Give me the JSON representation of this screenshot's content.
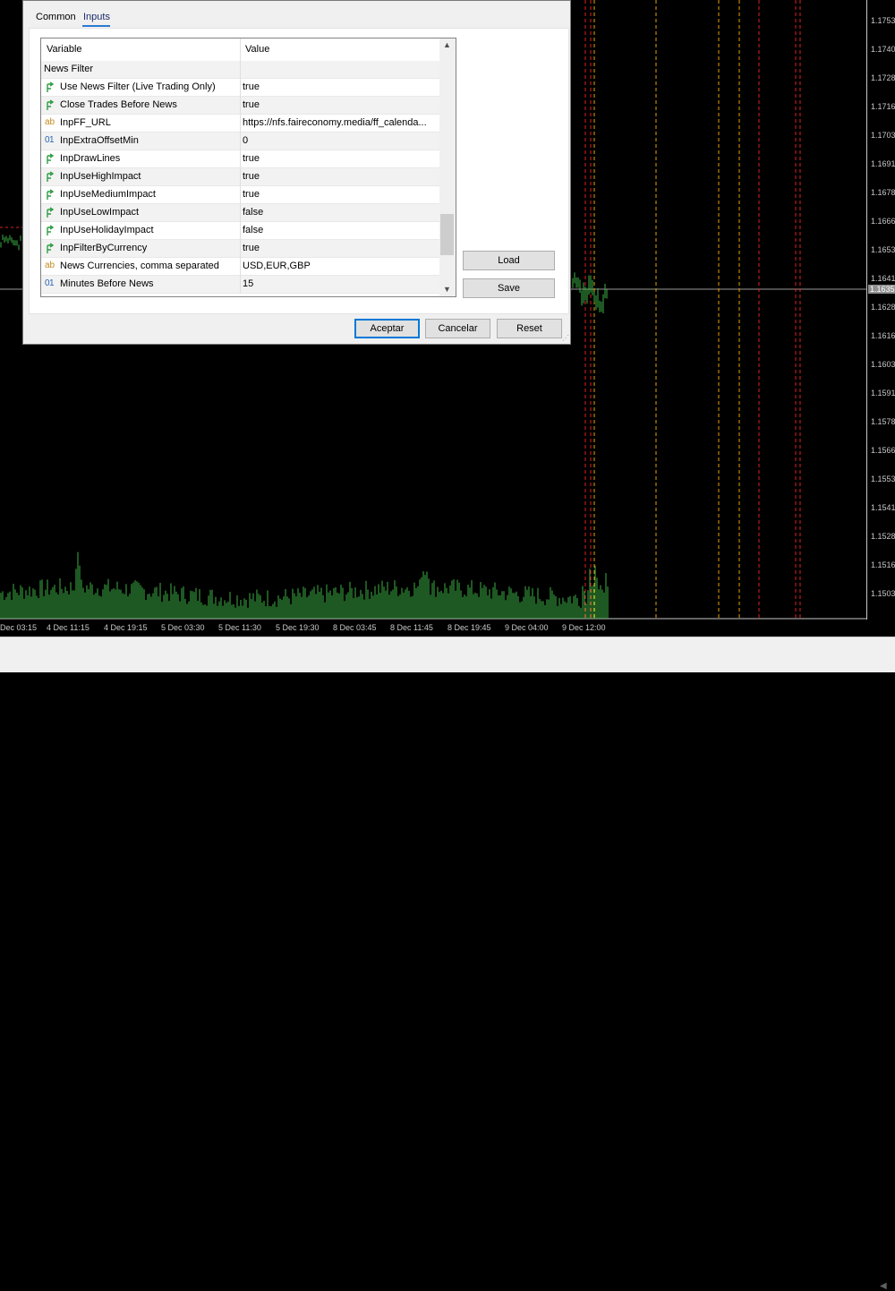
{
  "dialog": {
    "tabs": [
      {
        "label": "Common"
      },
      {
        "label": "Inputs"
      }
    ],
    "grid": {
      "headers": {
        "variable": "Variable",
        "value": "Value"
      },
      "rows": [
        {
          "type": "group",
          "name": "News Filter",
          "value": ""
        },
        {
          "type": "bool",
          "name": "Use News Filter (Live Trading Only)",
          "value": "true"
        },
        {
          "type": "bool",
          "name": "Close Trades Before News",
          "value": "true"
        },
        {
          "type": "string",
          "name": "InpFF_URL",
          "value": "https://nfs.faireconomy.media/ff_calenda..."
        },
        {
          "type": "int",
          "name": "InpExtraOffsetMin",
          "value": "0"
        },
        {
          "type": "bool",
          "name": "InpDrawLines",
          "value": "true"
        },
        {
          "type": "bool",
          "name": "InpUseHighImpact",
          "value": "true"
        },
        {
          "type": "bool",
          "name": "InpUseMediumImpact",
          "value": "true"
        },
        {
          "type": "bool",
          "name": "InpUseLowImpact",
          "value": "false"
        },
        {
          "type": "bool",
          "name": "InpUseHolidayImpact",
          "value": "false"
        },
        {
          "type": "bool",
          "name": "InpFilterByCurrency",
          "value": "true"
        },
        {
          "type": "string",
          "name": "News Currencies, comma separated",
          "value": "USD,EUR,GBP"
        },
        {
          "type": "int",
          "name": "Minutes Before News",
          "value": "15"
        }
      ],
      "icons": {
        "bool": "bool-arrow-icon",
        "string": "ab-string-icon",
        "int": "01-int-icon"
      },
      "icon_glyphs": {
        "string": "ab",
        "int": "01"
      }
    },
    "side_buttons": {
      "load": "Load",
      "save": "Save"
    },
    "footer_buttons": {
      "ok": "Aceptar",
      "cancel": "Cancelar",
      "reset": "Reset"
    }
  },
  "chart": {
    "price_labels": [
      "1.1753",
      "1.1740",
      "1.1728",
      "1.1716",
      "1.1703",
      "1.1691",
      "1.1678",
      "1.1666",
      "1.1653",
      "1.1641",
      "1.1628",
      "1.1616",
      "1.1603",
      "1.1591",
      "1.1578",
      "1.1566",
      "1.1553",
      "1.1541",
      "1.1528",
      "1.1516",
      "1.1503"
    ],
    "current_price": "1.1635",
    "time_labels": [
      "Dec 03:15",
      "4 Dec 11:15",
      "4 Dec 19:15",
      "5 Dec 03:30",
      "5 Dec 11:30",
      "5 Dec 19:30",
      "8 Dec 03:45",
      "8 Dec 11:45",
      "8 Dec 19:45",
      "9 Dec 04:00",
      "9 Dec 12:00"
    ],
    "colors": {
      "background": "#000000",
      "bars": "#3cb043",
      "axis": "#c8c8c8",
      "line_red": "#e02020",
      "line_orange": "#e8a000"
    }
  }
}
